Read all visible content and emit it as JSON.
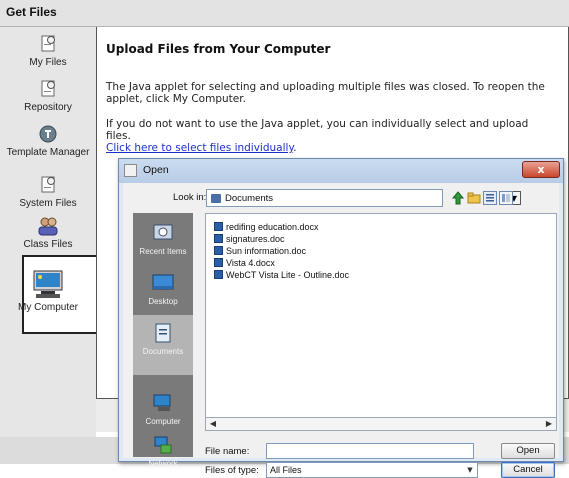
{
  "window": {
    "title": "Get Files"
  },
  "sidebar": {
    "items": [
      {
        "label": "My Files",
        "icon": "my-files-icon"
      },
      {
        "label": "Repository",
        "icon": "repository-icon"
      },
      {
        "label": "Template Manager",
        "icon": "template-manager-icon"
      },
      {
        "label": "System Files",
        "icon": "system-files-icon"
      },
      {
        "label": "Class Files",
        "icon": "class-files-icon"
      },
      {
        "label": "My Computer",
        "icon": "computer-icon",
        "selected": true
      }
    ]
  },
  "content": {
    "heading": "Upload Files from Your Computer",
    "paragraph1": "The Java applet for selecting and uploading multiple files was closed. To reopen the applet, click My Computer.",
    "paragraph2": "If you do not want to use the Java applet, you can individually select and upload files.",
    "link": "Click here to select files individually",
    "link_suffix": "."
  },
  "dialog": {
    "title": "Open",
    "close_label": "x",
    "look_in_label": "Look in:",
    "look_in_value": "Documents",
    "places": [
      "Recent Items",
      "Desktop",
      "Documents",
      "Computer",
      "Network"
    ],
    "selected_place": "Documents",
    "files": [
      "redifing education.docx",
      "signatures.doc",
      "Sun information.doc",
      "Vista 4.docx",
      "WebCT Vista Lite - Outline.doc"
    ],
    "file_name_label": "File name:",
    "file_name_value": "",
    "files_of_type_label": "Files of type:",
    "files_of_type_value": "All Files",
    "open_button": "Open",
    "cancel_button": "Cancel"
  },
  "colors": {
    "link": "#1a2fcc",
    "places_bg": "#7a7a7a",
    "close_button": "#c9462d"
  }
}
